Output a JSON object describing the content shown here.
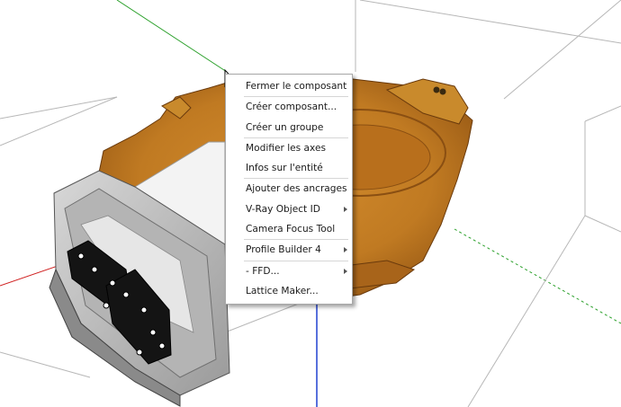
{
  "context_menu": {
    "items": [
      {
        "label": "Fermer le composant",
        "submenu": false
      },
      {
        "label": "Créer composant...",
        "submenu": false
      },
      {
        "label": "Créer un groupe",
        "submenu": false
      },
      {
        "label": "Modifier les axes",
        "submenu": false
      },
      {
        "label": "Infos sur l'entité",
        "submenu": false
      },
      {
        "label": "Ajouter des ancrages",
        "submenu": false
      },
      {
        "label": "V-Ray Object ID",
        "submenu": true
      },
      {
        "label": "Camera Focus Tool",
        "submenu": false
      },
      {
        "label": "Profile Builder 4",
        "submenu": true
      },
      {
        "label": "- FFD...",
        "submenu": true
      },
      {
        "label": "Lattice Maker...",
        "submenu": false
      }
    ]
  },
  "colors": {
    "model_body": "#c07a22",
    "model_shadow": "#8a4f12",
    "housing_gray": "#c8c8c8",
    "axis_red": "#d02020",
    "axis_green": "#2aa02a",
    "axis_blue": "#2040d0"
  }
}
